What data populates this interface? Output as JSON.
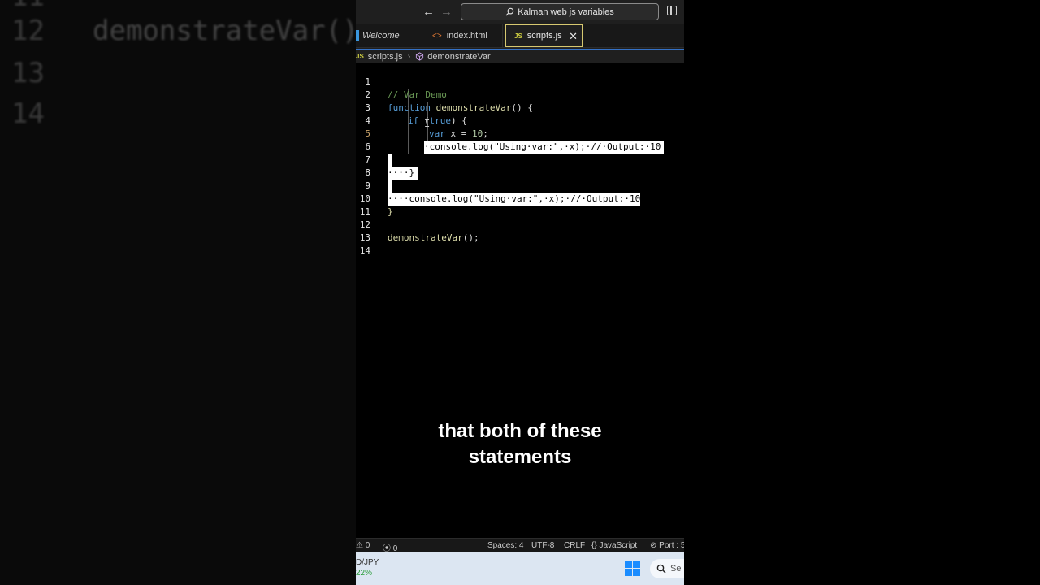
{
  "background": {
    "rows": [
      {
        "num": "11",
        "code": ""
      },
      {
        "num": "12",
        "code": "demonstrateVar()"
      },
      {
        "num": "13",
        "code": ""
      },
      {
        "num": "14",
        "code": ""
      }
    ]
  },
  "titlebar": {
    "back_icon": "←",
    "forward_icon": "→",
    "search_text": "Kalman web js variables"
  },
  "tabs": [
    {
      "label": "Welcome"
    },
    {
      "label": "index.html",
      "icon": "<>"
    },
    {
      "label": "scripts.js",
      "icon": "JS",
      "close": "✕"
    }
  ],
  "breadcrumb": {
    "icon": "JS",
    "file": "scripts.js",
    "separator": "›",
    "symbol": "demonstrateVar"
  },
  "editor": {
    "line_numbers": [
      "1",
      "2",
      "3",
      "4",
      "5",
      "6",
      "7",
      "8",
      "9",
      "10",
      "11",
      "12",
      "13",
      "14"
    ],
    "lines": {
      "l1": "// Var Demo",
      "l2_kw": "function",
      "l2_fn": "demonstrateVar",
      "l2_rest": "() {",
      "l3_kw": "if",
      "l3_rest1": " (",
      "l3_true": "true",
      "l3_rest2": ") {",
      "l4_kw": "var",
      "l4_mid": " x = ",
      "l4_num": "10",
      "l4_end": ";",
      "l5": "·console.log(\"Using·var:\",·x);·//·Output:·10",
      "l7": "····}",
      "l9": "····console.log(\"Using·var:\",·x);·//·Output:·10",
      "l10": "}",
      "l12_fn": "demonstrateVar",
      "l12_rest": "();"
    }
  },
  "statusbar": {
    "errors": "⚠ 0",
    "ports": "⦿ 0",
    "spaces": "Spaces: 4",
    "encoding": "UTF-8",
    "eol": "CRLF",
    "language": "{} JavaScript",
    "port": "⊘ Port : 5"
  },
  "taskbar": {
    "ticker_label": "D/JPY",
    "ticker_pct": "22%",
    "search_placeholder": "Se"
  },
  "caption": {
    "line1": "that both of these",
    "line2": "statements"
  }
}
